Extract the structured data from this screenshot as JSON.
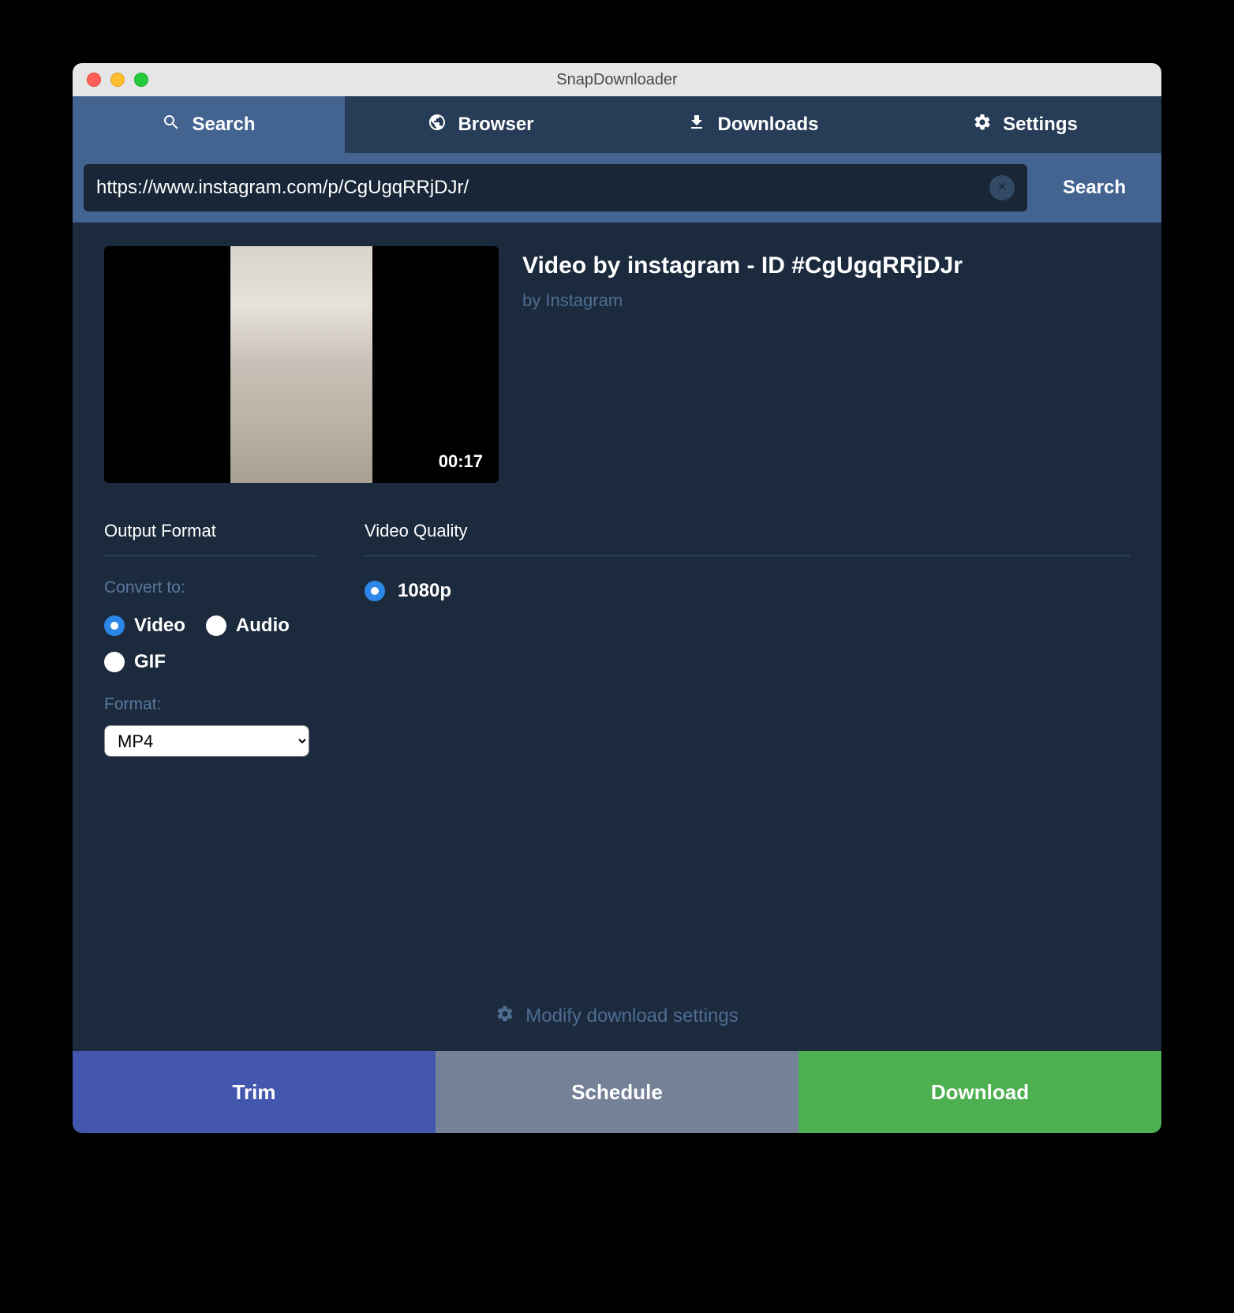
{
  "window": {
    "title": "SnapDownloader"
  },
  "tabs": {
    "search": "Search",
    "browser": "Browser",
    "downloads": "Downloads",
    "settings": "Settings"
  },
  "search": {
    "value": "https://www.instagram.com/p/CgUgqRRjDJr/",
    "button": "Search"
  },
  "video": {
    "title": "Video by instagram - ID #CgUgqRRjDJr",
    "author": "by Instagram",
    "duration": "00:17"
  },
  "output": {
    "section_title": "Output Format",
    "convert_label": "Convert to:",
    "options": {
      "video": "Video",
      "audio": "Audio",
      "gif": "GIF"
    },
    "format_label": "Format:",
    "format_value": "MP4"
  },
  "quality": {
    "section_title": "Video Quality",
    "options": {
      "q1080": "1080p"
    }
  },
  "modify": {
    "label": "Modify download settings"
  },
  "actions": {
    "trim": "Trim",
    "schedule": "Schedule",
    "download": "Download"
  }
}
